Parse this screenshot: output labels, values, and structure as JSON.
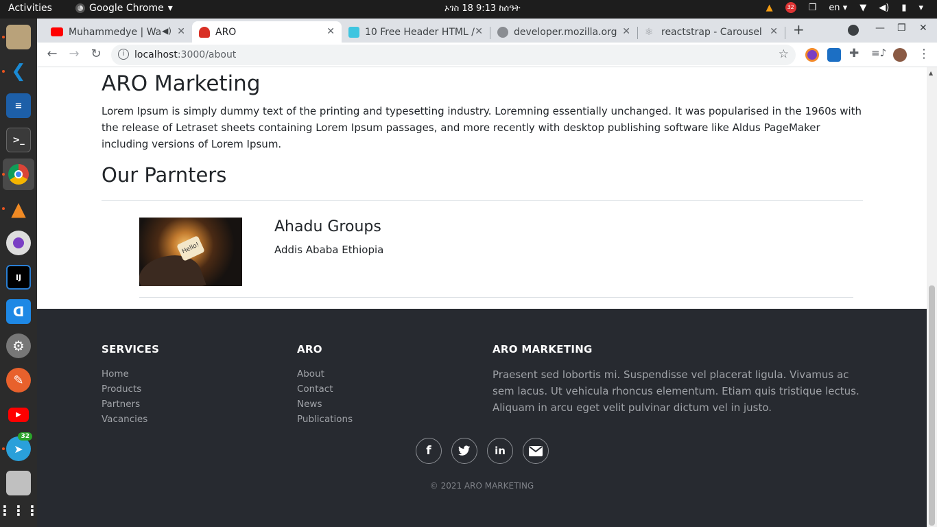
{
  "topbar": {
    "activities": "Activities",
    "app_name": "Google Chrome",
    "clock": "ኦገስ 18  9:13 ከሰዓት",
    "lang": "en",
    "vlc_badge": "32"
  },
  "dock": {
    "telegram_badge": "32",
    "ij_label": "IJ"
  },
  "tabs": [
    {
      "title": "Muhammedye | Wa",
      "icon": "youtube-icon"
    },
    {
      "title": "ARO",
      "icon": "aro-icon"
    },
    {
      "title": "10 Free Header HTML /",
      "icon": "page-icon"
    },
    {
      "title": "developer.mozilla.org",
      "icon": "globe-icon"
    },
    {
      "title": "reactstrap - Carousel",
      "icon": "react-icon"
    }
  ],
  "address": {
    "host": "localhost",
    "path": ":3000/about"
  },
  "page": {
    "title": "ARO Marketing",
    "intro": "Lorem Ipsum is simply dummy text of the printing and typesetting industry. Loremning essentially unchanged. It was popularised in the 1960s with the release of Letraset sheets containing Lorem Ipsum passages, and more recently with desktop publishing software like Aldus PageMaker including versions of Lorem Ipsum.",
    "partners_heading": "Our Parnters",
    "partner": {
      "name": "Ahadu Groups",
      "location": "Addis Ababa Ethiopia",
      "image_text": "Hello!"
    }
  },
  "footer": {
    "services": {
      "heading": "SERVICES",
      "links": [
        "Home",
        "Products",
        "Partners",
        "Vacancies"
      ]
    },
    "aro": {
      "heading": "ARO",
      "links": [
        "About",
        "Contact",
        "News",
        "Publications"
      ]
    },
    "marketing": {
      "heading": "ARO MARKETING",
      "text": "Praesent sed lobortis mi. Suspendisse vel placerat ligula. Vivamus ac sem lacus. Ut vehicula rhoncus elementum. Etiam quis tristique lectus. Aliquam in arcu eget velit pulvinar dictum vel in justo."
    },
    "social": [
      "facebook-icon",
      "twitter-icon",
      "linkedin-icon",
      "email-icon"
    ],
    "copyright": "© 2021 ARO MARKETING"
  },
  "colors": {
    "footer_bg": "#272a30",
    "accent": "#e95420"
  }
}
